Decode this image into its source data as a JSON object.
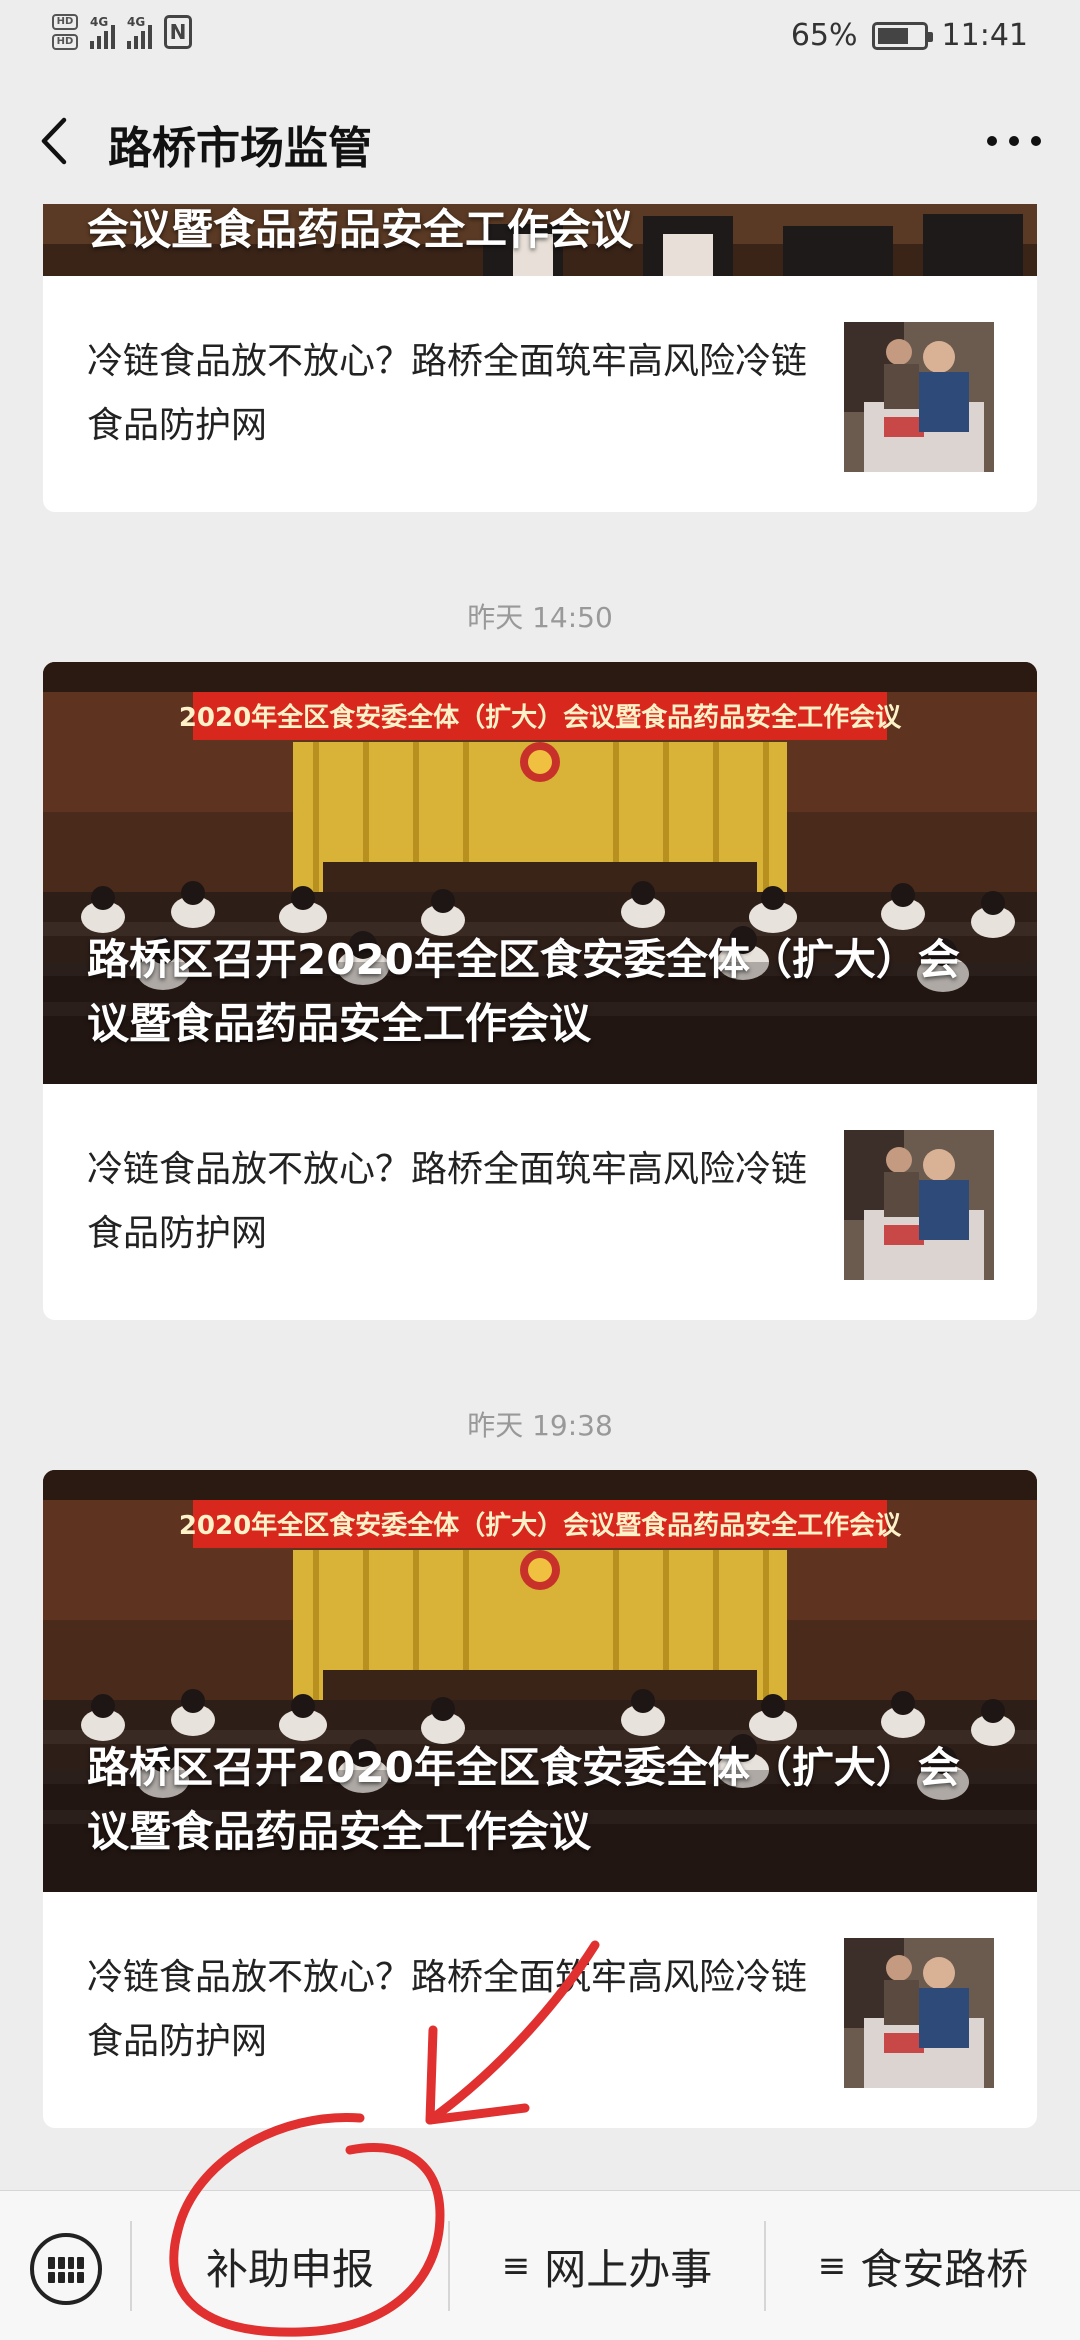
{
  "status": {
    "sim_tags": [
      "HD 1",
      "HD 2"
    ],
    "network_a": "4G",
    "network_b": "4G",
    "nfc": "N",
    "battery": "65%",
    "time": "11:41"
  },
  "nav": {
    "title": "路桥市场监管",
    "back_icon": "chevron-left-icon",
    "more_icon": "more-dots-icon"
  },
  "feed": {
    "partial_top": {
      "hero_title": "会议暨食品药品安全工作会议",
      "sub_title": "冷链食品放不放心？路桥全面筑牢高风险冷链食品防护网"
    },
    "groups": [
      {
        "time": "昨天 14:50",
        "banner_text": "2020年全区食安委全体（扩大）会议暨食品药品安全工作会议",
        "hero_title": "路桥区召开2020年全区食安委全体（扩大）会议暨食品药品安全工作会议",
        "sub_title": "冷链食品放不放心？路桥全面筑牢高风险冷链食品防护网"
      },
      {
        "time": "昨天 19:38",
        "banner_text": "2020年全区食安委全体（扩大）会议暨食品药品安全工作会议",
        "hero_title": "路桥区召开2020年全区食安委全体（扩大）会议暨食品药品安全工作会议",
        "sub_title": "冷链食品放不放心？路桥全面筑牢高风险冷链食品防护网"
      }
    ]
  },
  "tabbar": {
    "keyboard_icon": "keyboard-icon",
    "tabs": [
      {
        "label": "补助申报",
        "has_menu": false
      },
      {
        "label": "网上办事",
        "has_menu": true
      },
      {
        "label": "食安路桥",
        "has_menu": true
      }
    ],
    "menu_glyph": "≡"
  },
  "colors": {
    "background": "#ededed",
    "card": "#ffffff",
    "timestamp": "#999999",
    "annotation": "#e03030",
    "banner_red": "#d8281e"
  }
}
